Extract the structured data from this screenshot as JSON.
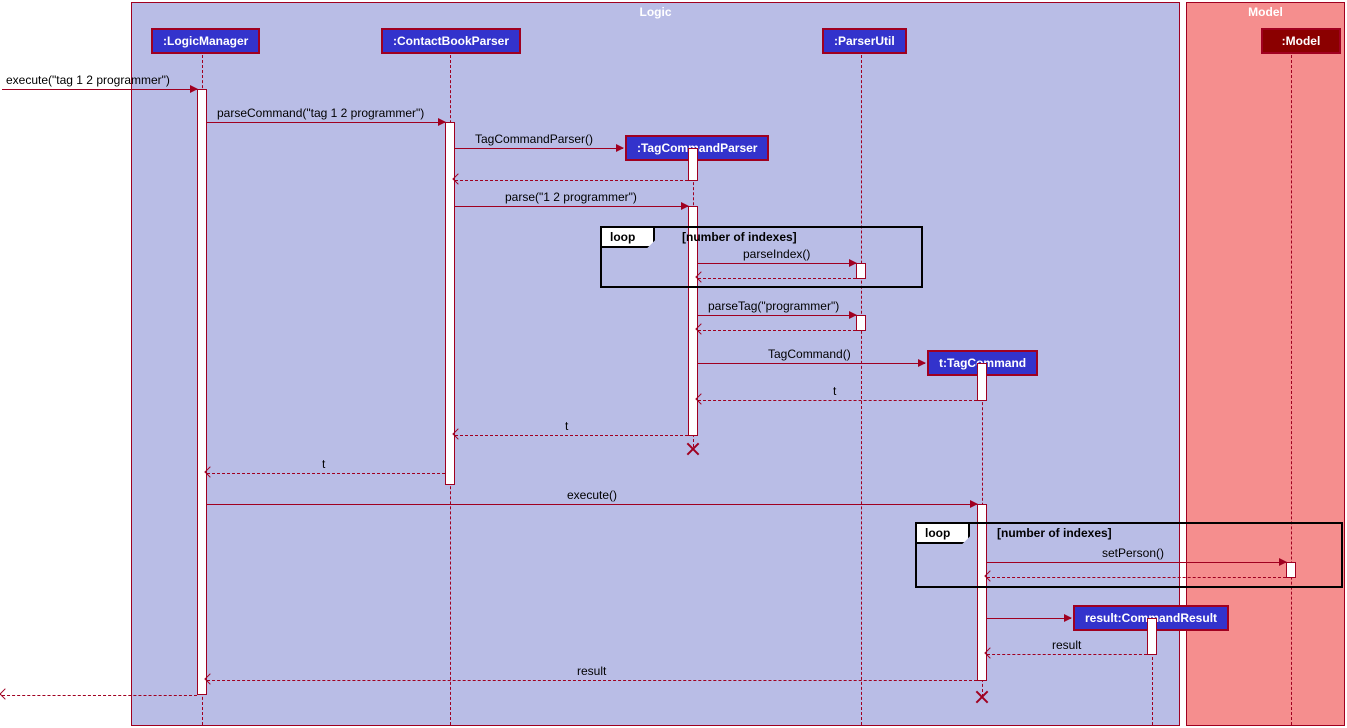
{
  "frames": {
    "logic": {
      "title": "Logic"
    },
    "model": {
      "title": "Model"
    }
  },
  "participants": {
    "logicManager": ":LogicManager",
    "contactBookParser": ":ContactBookParser",
    "tagCommandParser": ":TagCommandParser",
    "parserUtil": ":ParserUtil",
    "tagCommand": "t:TagCommand",
    "commandResult": "result:CommandResult",
    "model": ":Model"
  },
  "messages": {
    "m1": "execute(\"tag 1 2 programmer\")",
    "m2": "parseCommand(\"tag 1 2 programmer\")",
    "m3": "TagCommandParser()",
    "m4": "parse(\"1 2 programmer\")",
    "m5": "parseIndex()",
    "m6": "parseTag(\"programmer\")",
    "m7": "TagCommand()",
    "r1": "t",
    "r2": "t",
    "r3": "t",
    "m8": "execute()",
    "m9": "setPerson()",
    "r4": "result",
    "r5": "result"
  },
  "loops": {
    "l1": {
      "label": "loop",
      "guard": "[number of indexes]"
    },
    "l2": {
      "label": "loop",
      "guard": "[number of indexes]"
    }
  }
}
